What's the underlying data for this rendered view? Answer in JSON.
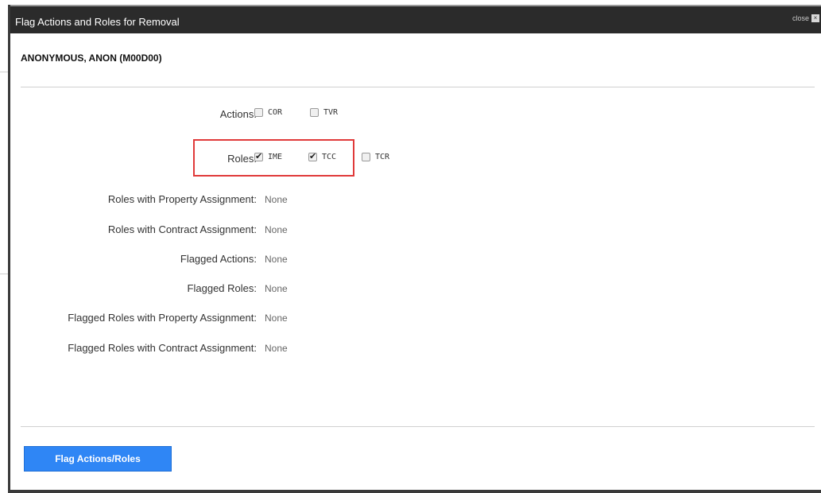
{
  "dialog": {
    "title": "Flag Actions and Roles for Removal",
    "close_label": "close",
    "close_icon": "×"
  },
  "user": {
    "name": "ANONYMOUS, ANON (M00D00)"
  },
  "actions": {
    "label": "Actions:",
    "options": [
      {
        "code": "COR",
        "checked": false
      },
      {
        "code": "TVR",
        "checked": false
      }
    ]
  },
  "roles": {
    "label": "Roles:",
    "options": [
      {
        "code": "IME",
        "checked": true
      },
      {
        "code": "TCC",
        "checked": true
      },
      {
        "code": "TCR",
        "checked": false
      }
    ]
  },
  "details": [
    {
      "label": "Roles with Property Assignment:",
      "value": "None"
    },
    {
      "label": "Roles with Contract Assignment:",
      "value": "None"
    },
    {
      "label": "Flagged Actions:",
      "value": "None"
    },
    {
      "label": "Flagged Roles:",
      "value": "None"
    },
    {
      "label": "Flagged Roles with Property Assignment:",
      "value": "None"
    },
    {
      "label": "Flagged Roles with Contract Assignment:",
      "value": "None"
    }
  ],
  "footer": {
    "button_label": "Flag Actions/Roles"
  },
  "colors": {
    "titlebar": "#2b2b2b",
    "button": "#2f86f5",
    "highlight": "#e03a3a"
  }
}
